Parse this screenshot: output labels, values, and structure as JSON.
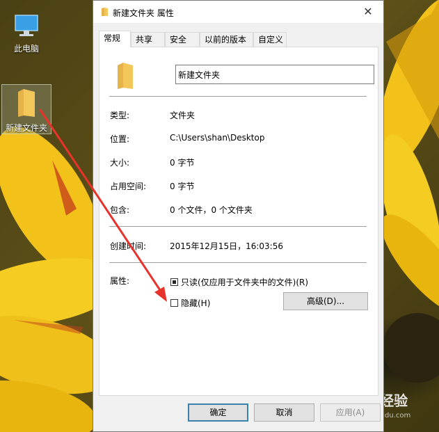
{
  "desktop": {
    "icons": [
      {
        "label": "此电脑",
        "icon": "computer-icon"
      },
      {
        "label": "新建文件夹",
        "icon": "folder-icon"
      }
    ],
    "watermark": "Baidu 经验",
    "watermark_url": "jingyan.baidu.com"
  },
  "dialog": {
    "title": "新建文件夹 属性",
    "close_label": "✕",
    "tabs": [
      {
        "label": "常规",
        "active": true
      },
      {
        "label": "共享"
      },
      {
        "label": "安全"
      },
      {
        "label": "以前的版本"
      },
      {
        "label": "自定义"
      }
    ],
    "folder_name": "新建文件夹",
    "rows": [
      {
        "label": "类型:",
        "value": "文件夹"
      },
      {
        "label": "位置:",
        "value": "C:\\Users\\shan\\Desktop"
      },
      {
        "label": "大小:",
        "value": "0 字节"
      },
      {
        "label": "占用空间:",
        "value": "0 字节"
      },
      {
        "label": "包含:",
        "value": "0 个文件，0 个文件夹"
      },
      {
        "label": "创建时间:",
        "value": "2015年12月15日，16:03:56"
      }
    ],
    "attributes_label": "属性:",
    "readonly_label": "只读(仅应用于文件夹中的文件)(R)",
    "readonly_state": "indeterminate",
    "hidden_label": "隐藏(H)",
    "hidden_checked": false,
    "advanced_label": "高级(D)...",
    "ok_label": "确定",
    "cancel_label": "取消",
    "apply_label": "应用(A)"
  },
  "colors": {
    "arrow": "#e8332c",
    "folder": "#f3c75a",
    "default_button_border": "#3c7fb1"
  }
}
